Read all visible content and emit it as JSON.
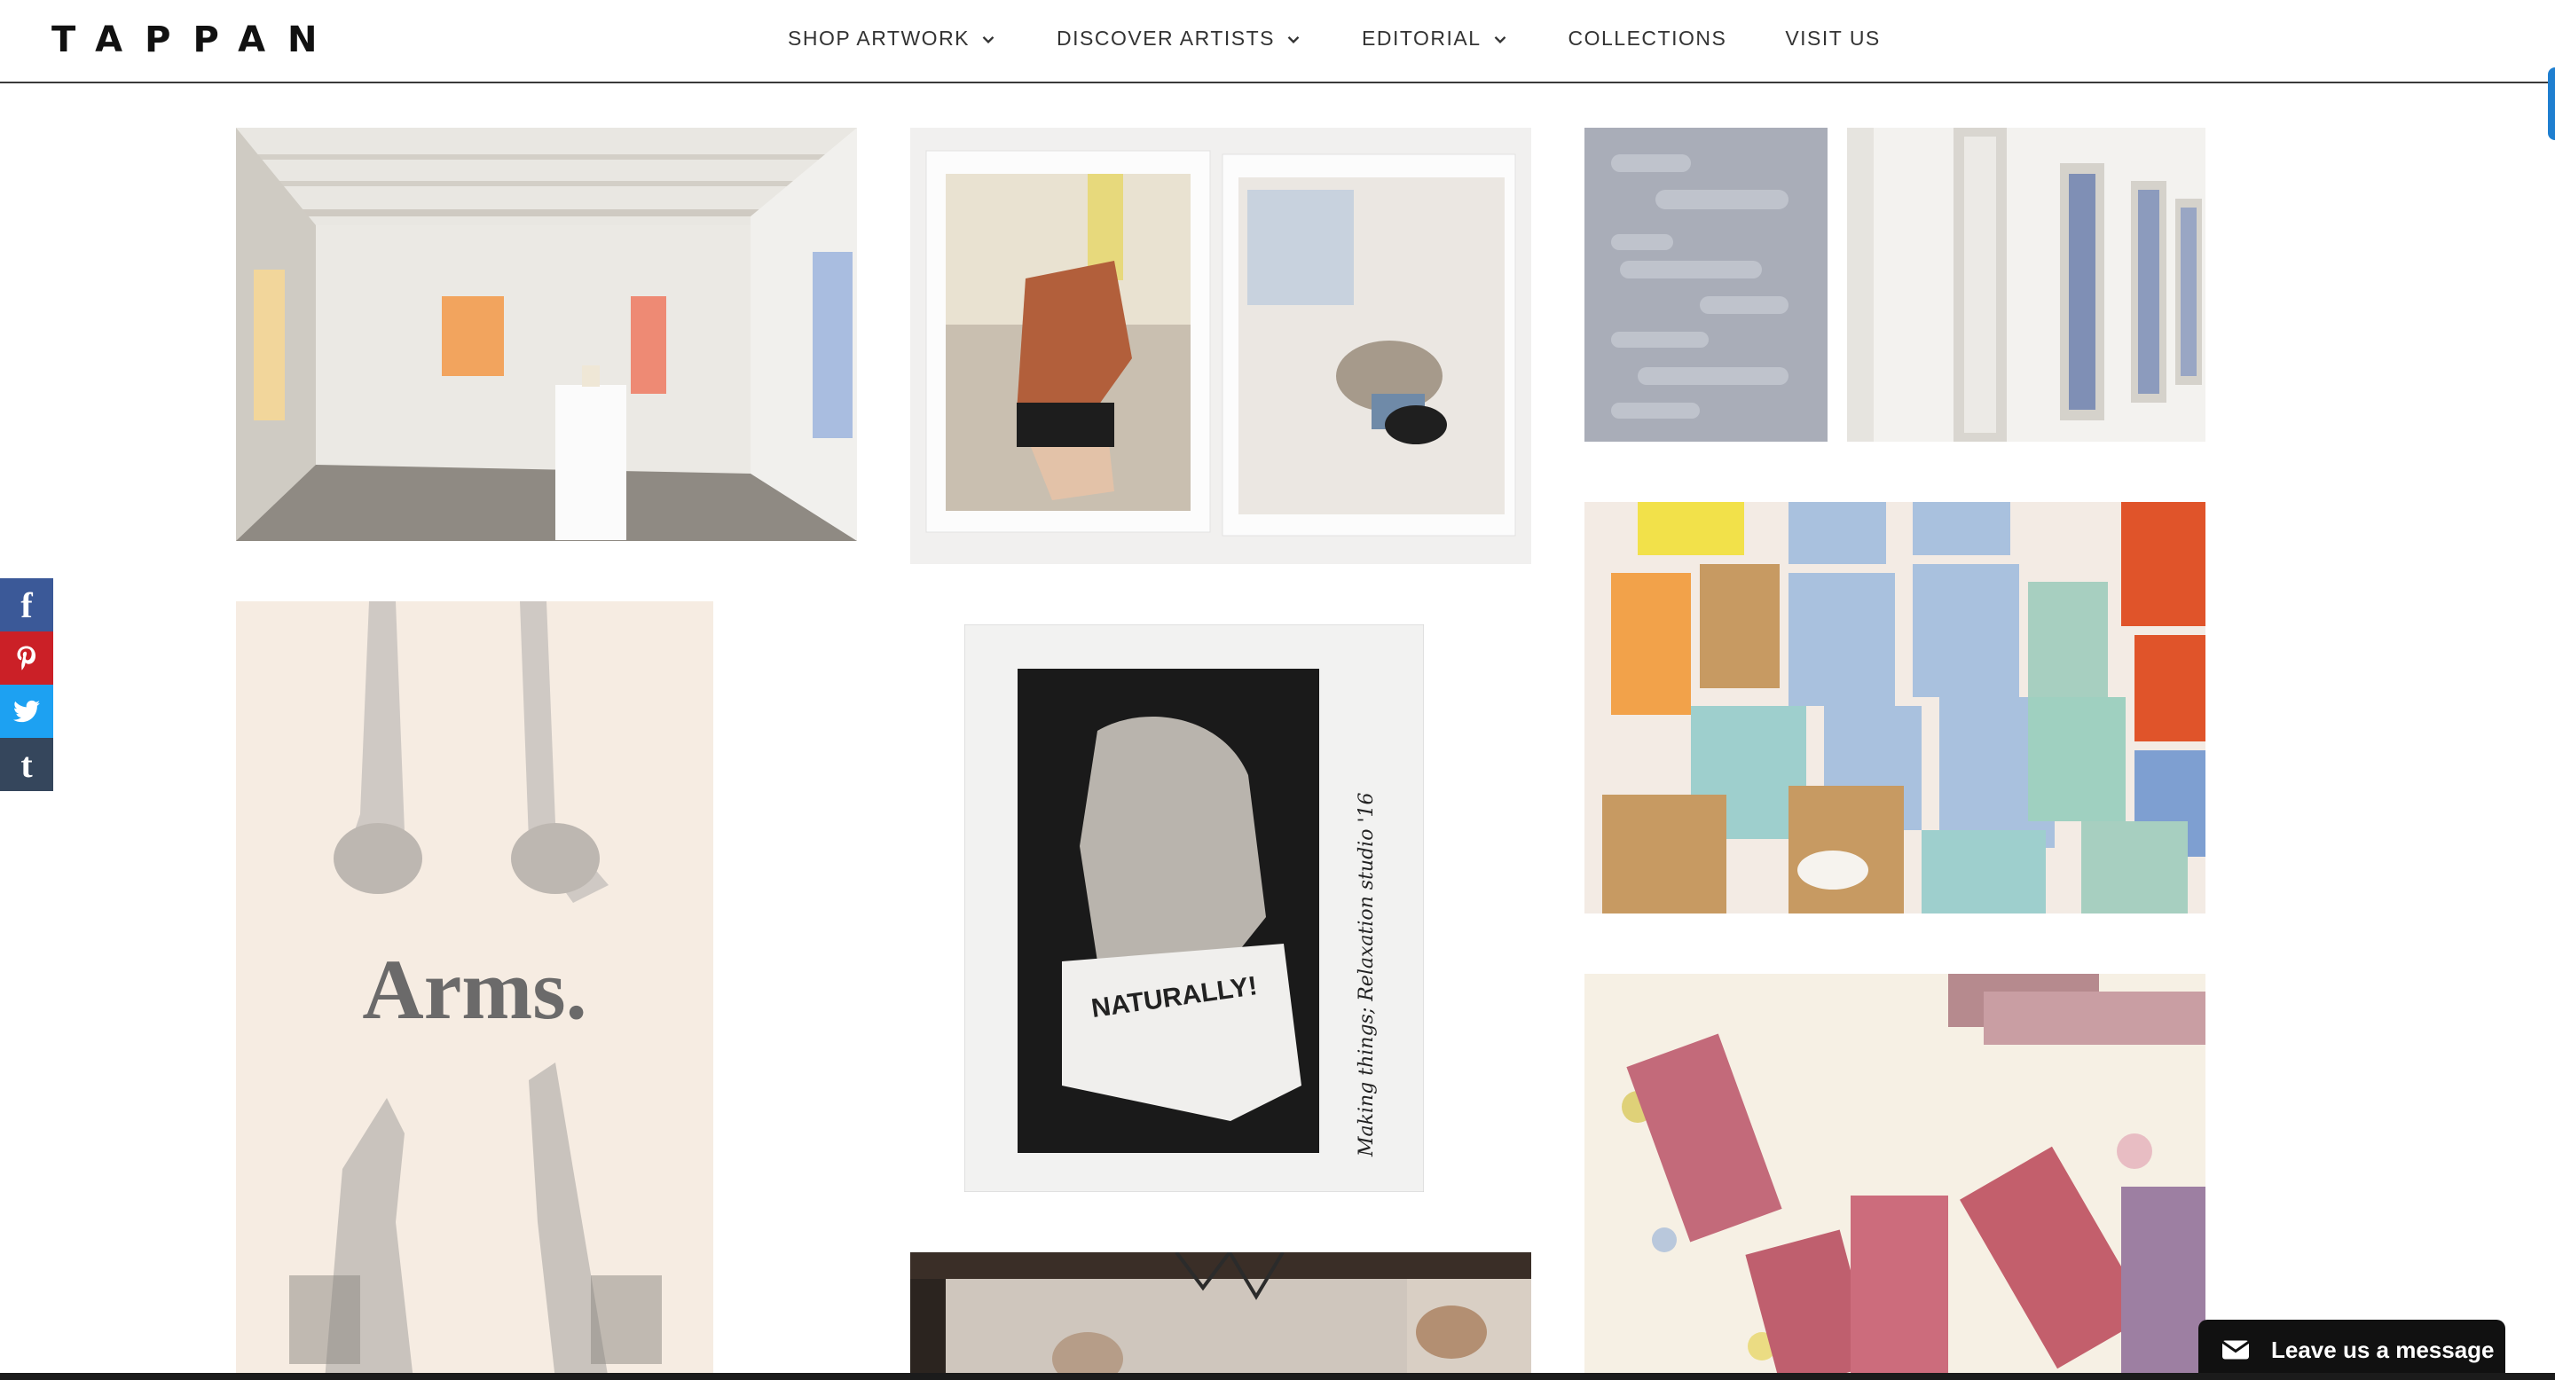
{
  "header": {
    "logo": "TAPPAN",
    "nav": [
      {
        "label": "SHOP ARTWORK",
        "has_dropdown": true
      },
      {
        "label": "DISCOVER ARTISTS",
        "has_dropdown": true
      },
      {
        "label": "EDITORIAL",
        "has_dropdown": true
      },
      {
        "label": "COLLECTIONS",
        "has_dropdown": false
      },
      {
        "label": "VISIT US",
        "has_dropdown": false
      }
    ]
  },
  "share": [
    {
      "network": "facebook",
      "icon": "facebook-icon",
      "glyph": "f",
      "color": "#3b5998"
    },
    {
      "network": "pinterest",
      "icon": "pinterest-icon",
      "color": "#cb2027"
    },
    {
      "network": "twitter",
      "icon": "twitter-icon",
      "color": "#1da1f2"
    },
    {
      "network": "tumblr",
      "icon": "tumblr-icon",
      "glyph": "t",
      "color": "#35465c"
    }
  ],
  "gallery": {
    "poster_text": "Arms.",
    "shirt_text": "NATURALLY!",
    "handwritten_caption": "Making things; Relaxation studio '16"
  },
  "chat": {
    "label": "Leave us a message",
    "icon": "envelope-icon"
  },
  "colors": {
    "accent_tab": "#1f7fd0",
    "chat_bg": "#111111"
  }
}
